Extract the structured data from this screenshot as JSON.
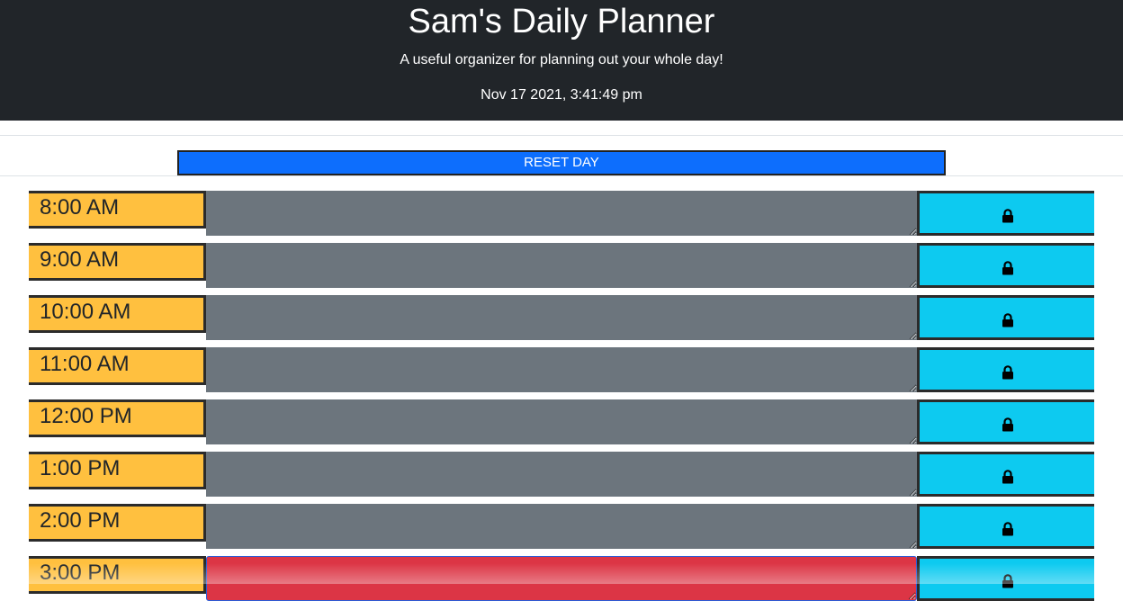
{
  "header": {
    "title": "Sam's Daily Planner",
    "subtitle": "A useful organizer for planning out your whole day!",
    "datetime": "Nov 17 2021, 3:41:49 pm"
  },
  "reset_button": {
    "label": "RESET DAY"
  },
  "colors": {
    "header_bg": "#212529",
    "hour_bg": "#ffc03f",
    "past_bg": "#6c757d",
    "present_bg": "#dc3545",
    "save_bg": "#0dcaf0",
    "reset_bg": "#0d6efd"
  },
  "hours": [
    {
      "label": "8:00 AM",
      "status": "past",
      "task": ""
    },
    {
      "label": "9:00 AM",
      "status": "past",
      "task": ""
    },
    {
      "label": "10:00 AM",
      "status": "past",
      "task": ""
    },
    {
      "label": "11:00 AM",
      "status": "past",
      "task": ""
    },
    {
      "label": "12:00 PM",
      "status": "past",
      "task": ""
    },
    {
      "label": "1:00 PM",
      "status": "past",
      "task": ""
    },
    {
      "label": "2:00 PM",
      "status": "past",
      "task": ""
    },
    {
      "label": "3:00 PM",
      "status": "present",
      "task": ""
    }
  ],
  "save_icon": "lock-icon"
}
